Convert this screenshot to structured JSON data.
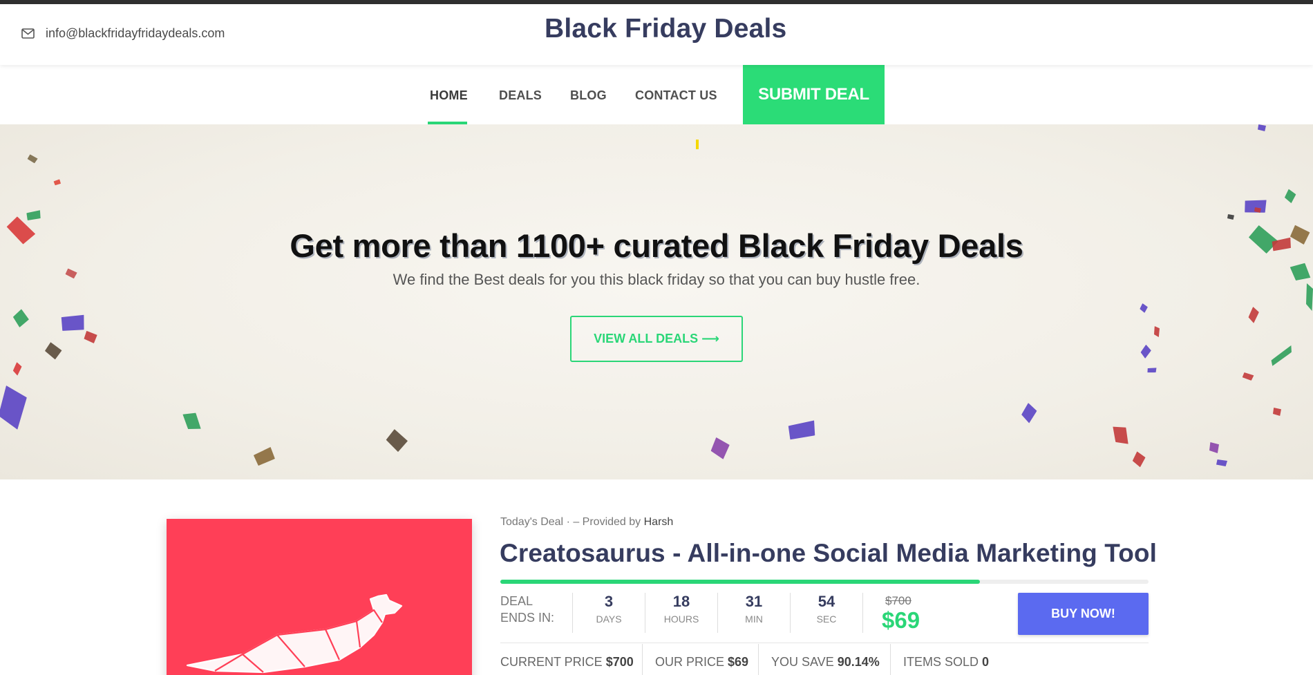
{
  "header": {
    "email": "info@blackfridayfridaydeals.com",
    "site_title": "Black Friday Deals"
  },
  "nav": {
    "items": [
      {
        "label": "HOME",
        "active": true
      },
      {
        "label": "DEALS"
      },
      {
        "label": "BLOG"
      },
      {
        "label": "CONTACT US"
      }
    ],
    "submit_label": "SUBMIT DEAL"
  },
  "hero": {
    "title": "Get more than 1100+ curated Black Friday Deals",
    "subtitle": "We find the Best deals for you this black friday so that you can buy hustle free.",
    "button_label": "VIEW ALL DEALS ⟶"
  },
  "deal": {
    "label": "Today's Deal",
    "provided_prefix": "· – Provided by",
    "provider": "Harsh",
    "title": "Creatosaurus - All-in-one Social Media Marketing Tool",
    "progress_fraction": 0.74,
    "ends_in_label": "DEAL ENDS IN:",
    "countdown": [
      {
        "value": "3",
        "unit": "DAYS"
      },
      {
        "value": "18",
        "unit": "HOURS"
      },
      {
        "value": "31",
        "unit": "MIN"
      },
      {
        "value": "54",
        "unit": "SEC"
      }
    ],
    "old_price": "$700",
    "new_price": "$69",
    "buy_label": "BUY NOW!",
    "stats": [
      {
        "label": "CURRENT PRICE",
        "value": "$700"
      },
      {
        "label": "OUR PRICE",
        "value": "$69"
      },
      {
        "label": "YOU SAVE",
        "value": "90.14%"
      },
      {
        "label": "ITEMS SOLD",
        "value": "0"
      }
    ]
  },
  "colors": {
    "accent_green": "#2ad677",
    "title_navy": "#363c5f",
    "buy_blue": "#5b6af0",
    "deal_image_red": "#ff3f57"
  },
  "icons": [
    "mail-icon",
    "arrow-right-icon",
    "dinosaur-logo"
  ]
}
